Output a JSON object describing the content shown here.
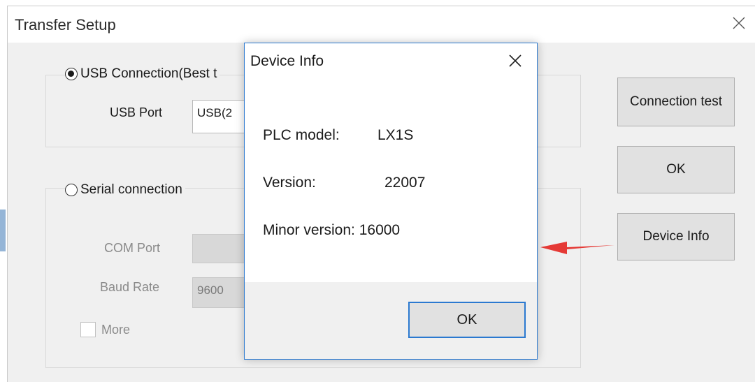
{
  "window": {
    "title": "Transfer Setup",
    "close_icon": "close-icon"
  },
  "usb_group": {
    "radio_label": "USB Connection(Best t",
    "selected": true,
    "port_label": "USB Port",
    "port_value": "USB(2"
  },
  "serial_group": {
    "radio_label": "Serial connection",
    "selected": false,
    "com_label": "COM Port",
    "com_value": "",
    "baud_label": "Baud Rate",
    "baud_value": "9600",
    "more_label": "More",
    "more_checked": false
  },
  "side_buttons": {
    "connection_test": "Connection test",
    "ok": "OK",
    "device_info": "Device Info"
  },
  "annotation": {
    "arrow_color": "#e53935"
  },
  "dialog": {
    "title": "Device Info",
    "plc_model_label": "PLC model:",
    "plc_model_value": "LX1S",
    "version_label": "Version:",
    "version_value": "22007",
    "minor_version_text": "Minor version: 16000",
    "ok_label": "OK",
    "accent_color": "#2b79d0"
  }
}
